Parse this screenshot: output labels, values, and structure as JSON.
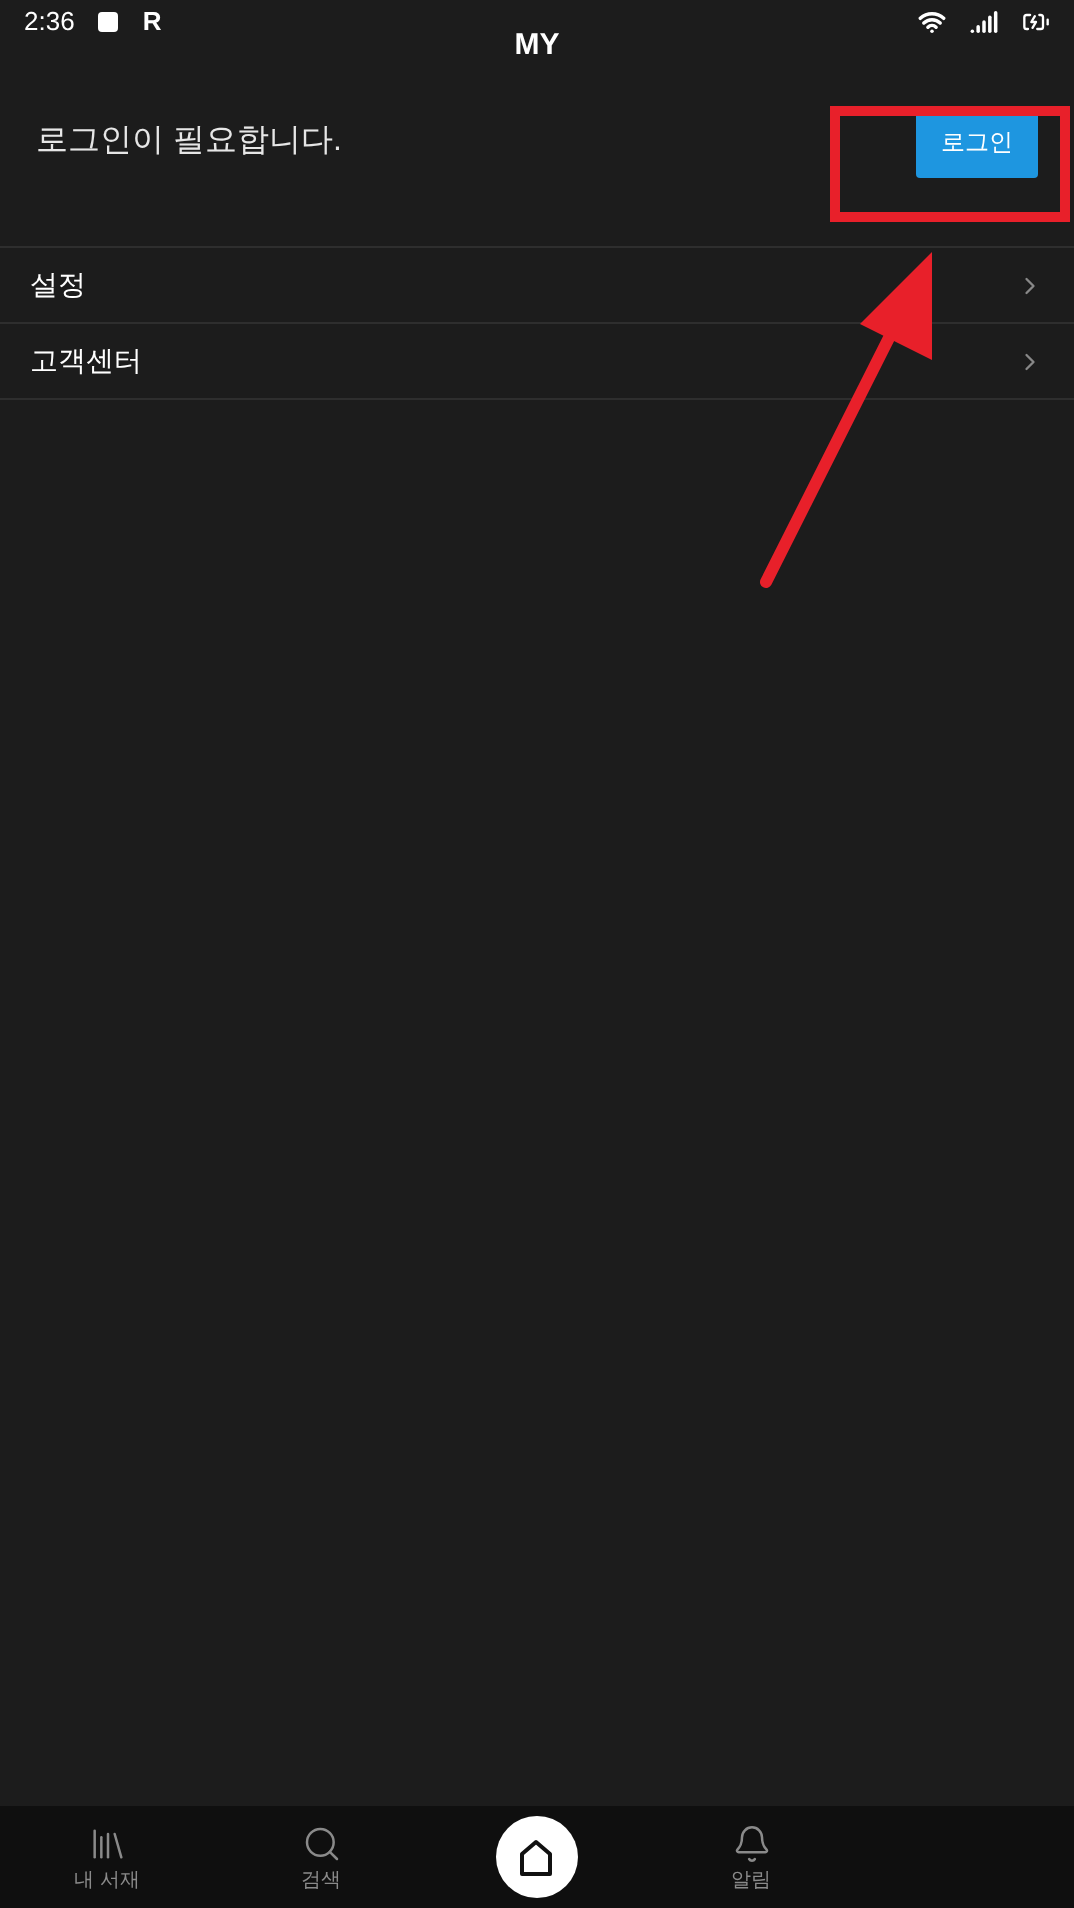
{
  "status_bar": {
    "time": "2:36",
    "notification_letter": "R"
  },
  "header": {
    "title": "MY"
  },
  "login_prompt": {
    "message": "로그인이 필요합니다.",
    "button": "로그인"
  },
  "menu": [
    {
      "label": "설정"
    },
    {
      "label": "고객센터"
    }
  ],
  "bottom_nav": [
    {
      "label": "내 서재"
    },
    {
      "label": "검색"
    },
    {
      "label": "알림"
    }
  ]
}
